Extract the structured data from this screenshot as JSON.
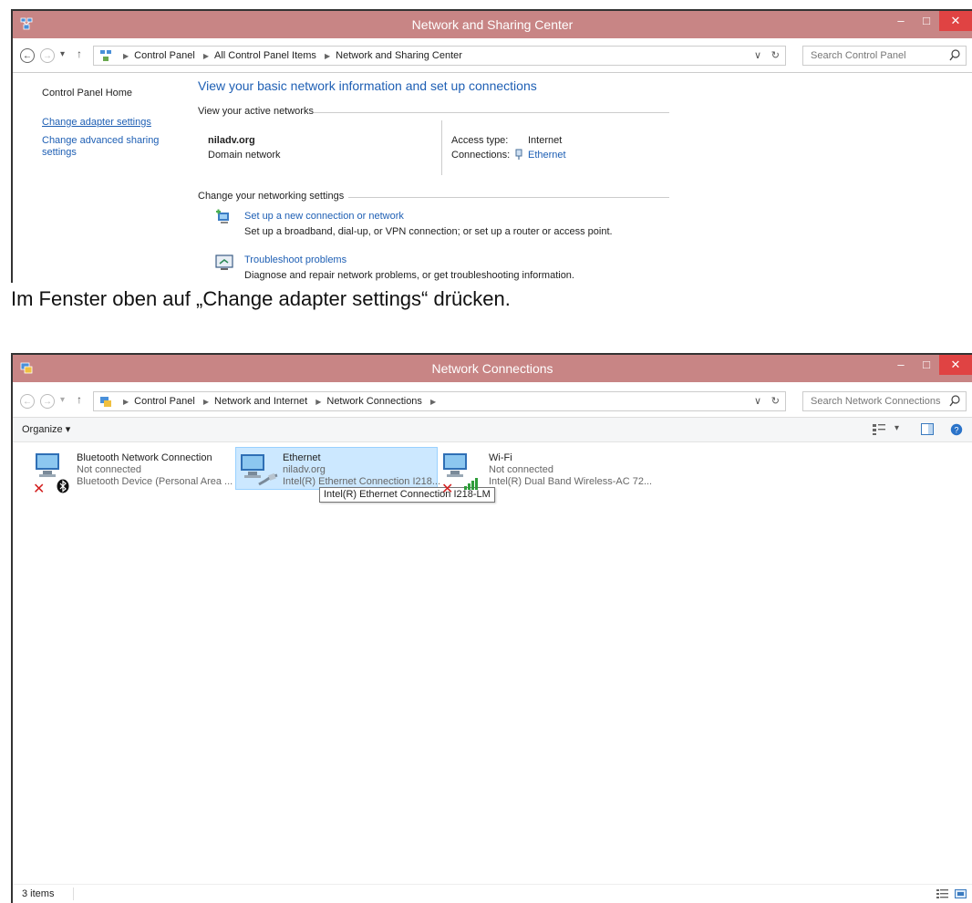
{
  "window1": {
    "title": "Network and Sharing Center",
    "breadcrumb": [
      "Control Panel",
      "All Control Panel Items",
      "Network and Sharing Center"
    ],
    "search_placeholder": "Search Control Panel",
    "sidebar": {
      "home": "Control Panel Home",
      "items": [
        "Change adapter settings",
        "Change advanced sharing settings"
      ]
    },
    "heading": "View your basic network information and set up connections",
    "active_networks_label": "View your active networks",
    "network": {
      "name": "niladv.org",
      "type": "Domain network",
      "access_type_label": "Access type:",
      "access_type_value": "Internet",
      "connections_label": "Connections:",
      "connections_value": "Ethernet"
    },
    "change_settings_label": "Change your networking settings",
    "tasks": [
      {
        "title": "Set up a new connection or network",
        "desc": "Set up a broadband, dial-up, or VPN connection; or set up a router or access point."
      },
      {
        "title": "Troubleshoot problems",
        "desc": "Diagnose and repair network problems, or get troubleshooting information."
      }
    ]
  },
  "caption": "Im Fenster oben auf „Change adapter settings“ drücken.",
  "window2": {
    "title": "Network Connections",
    "breadcrumb": [
      "Control Panel",
      "Network and Internet",
      "Network Connections"
    ],
    "search_placeholder": "Search Network Connections",
    "organize_label": "Organize ▾",
    "connections": [
      {
        "name": "Bluetooth Network Connection",
        "status": "Not connected",
        "device": "Bluetooth Device (Personal Area ..."
      },
      {
        "name": "Ethernet",
        "status": "niladv.org",
        "device": "Intel(R) Ethernet Connection I218..."
      },
      {
        "name": "Wi-Fi",
        "status": "Not connected",
        "device": "Intel(R) Dual Band Wireless-AC 72..."
      }
    ],
    "tooltip": "Intel(R) Ethernet Connection I218-LM",
    "status_bar": "3 items"
  },
  "colors": {
    "titlebar": "#c88585",
    "close_button": "#e04343",
    "link": "#1e5fb4",
    "selection_bg": "#cce8ff"
  }
}
